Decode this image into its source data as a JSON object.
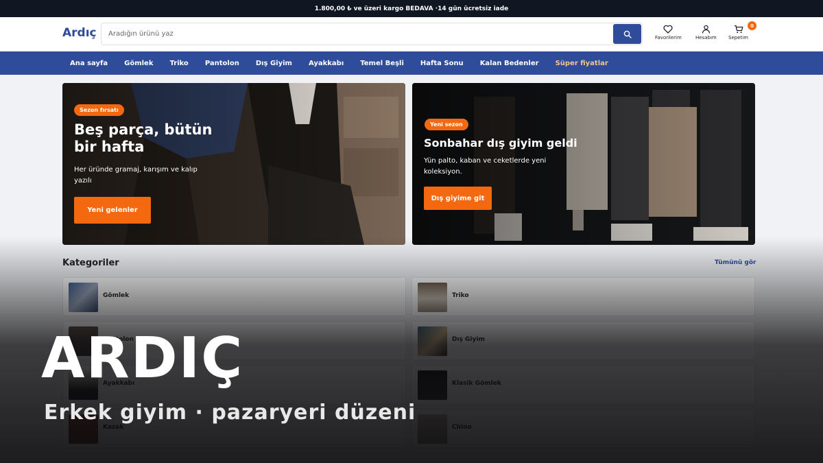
{
  "promo_bar": {
    "text": "1.800,00 ₺ ve üzeri kargo BEDAVA ·14 gün ücretsiz iade"
  },
  "header": {
    "logo": "Ardıç",
    "search_placeholder": "Aradığın ürünü yaz",
    "actions": {
      "favorites": "Favorilerim",
      "account": "Hesabım",
      "cart": "Sepetim",
      "cart_count": "0"
    }
  },
  "nav": {
    "items": [
      "Ana sayfa",
      "Gömlek",
      "Triko",
      "Pantolon",
      "Dış Giyim",
      "Ayakkabı",
      "Temel Beşli",
      "Hafta Sonu",
      "Kalan Bedenler",
      "Süper fiyatlar"
    ]
  },
  "banners": {
    "left": {
      "badge": "Sezon fırsatı",
      "title_line1": "Beş parça, bütün",
      "title_line2": "bir hafta",
      "desc_line1": "Her üründe gramaj, karışım ve kalıp",
      "desc_line2": "yazılı",
      "button": "Yeni gelenler"
    },
    "right": {
      "badge": "Yeni sezon",
      "title": "Sonbahar dış giyim geldi",
      "desc_line1": "Yün palto, kaban ve ceketlerde yeni",
      "desc_line2": "koleksiyon.",
      "button": "Dış giyime git"
    }
  },
  "categories": {
    "title": "Kategoriler",
    "see_all": "Tümünü gör",
    "items": [
      "Gömlek",
      "Triko",
      "Pantolon",
      "Dış Giyim",
      "Ayakkabı",
      "Klasik Gömlek",
      "Kazak",
      "Chino"
    ]
  },
  "overlay": {
    "title": "ARDIÇ",
    "subtitle": "Erkek giyim · pazaryeri düzeni"
  },
  "colors": {
    "brand_blue": "#2e4c9a",
    "accent_orange": "#f4680f",
    "promo_bg": "#101622",
    "highlight_nav": "#f5c68d"
  }
}
